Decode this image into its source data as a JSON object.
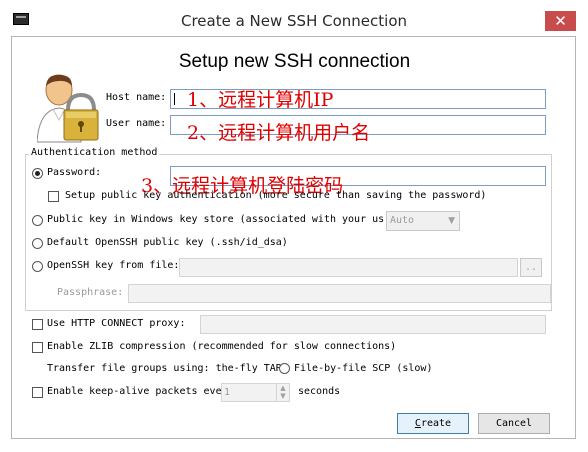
{
  "window": {
    "title": "Create a New SSH Connection",
    "close_glyph": "✕",
    "icon": "terminal-app-icon"
  },
  "header": {
    "title": "Setup new SSH connection"
  },
  "fields": {
    "host_label": "Host name:",
    "host_value": "",
    "user_label": "User name:",
    "user_value": "",
    "password_value": ""
  },
  "annotations": {
    "host": "1、远程计算机IP",
    "user": "2、远程计算机用户名",
    "password": "3、远程计算机登陆密码",
    "color": "#e00000"
  },
  "auth": {
    "group_label": "Authentication method",
    "password_label": "Password:",
    "pubkey_auth_label": "Setup public key authentication (more secure than saving the password)",
    "pubkey_store_label": "Public key in Windows key store (associated with your us",
    "keystore_select_value": "Auto",
    "default_key_label": "Default OpenSSH public key (.ssh/id_dsa)",
    "openssh_file_label": "OpenSSH key from file:",
    "browse_label": "..",
    "passphrase_label": "Passphrase:",
    "selected": "password"
  },
  "options": {
    "http_connect_label": "Use HTTP CONNECT proxy:",
    "zlib_label": "Enable ZLIB compression (recommended for slow connections)",
    "transfer_label": "Transfer file groups using: the-fly TAR",
    "file_by_file_label": "File-by-file SCP (slow)",
    "keepalive_label": "Enable keep-alive packets eve",
    "keepalive_value": "1",
    "seconds_label": "seconds"
  },
  "buttons": {
    "create_label": "Create",
    "create_underline": "C",
    "create_rest": "reate",
    "cancel_label": "Cancel"
  },
  "colors": {
    "close_button": "#c94c4c",
    "default_button_border": "#3c7fb1"
  }
}
